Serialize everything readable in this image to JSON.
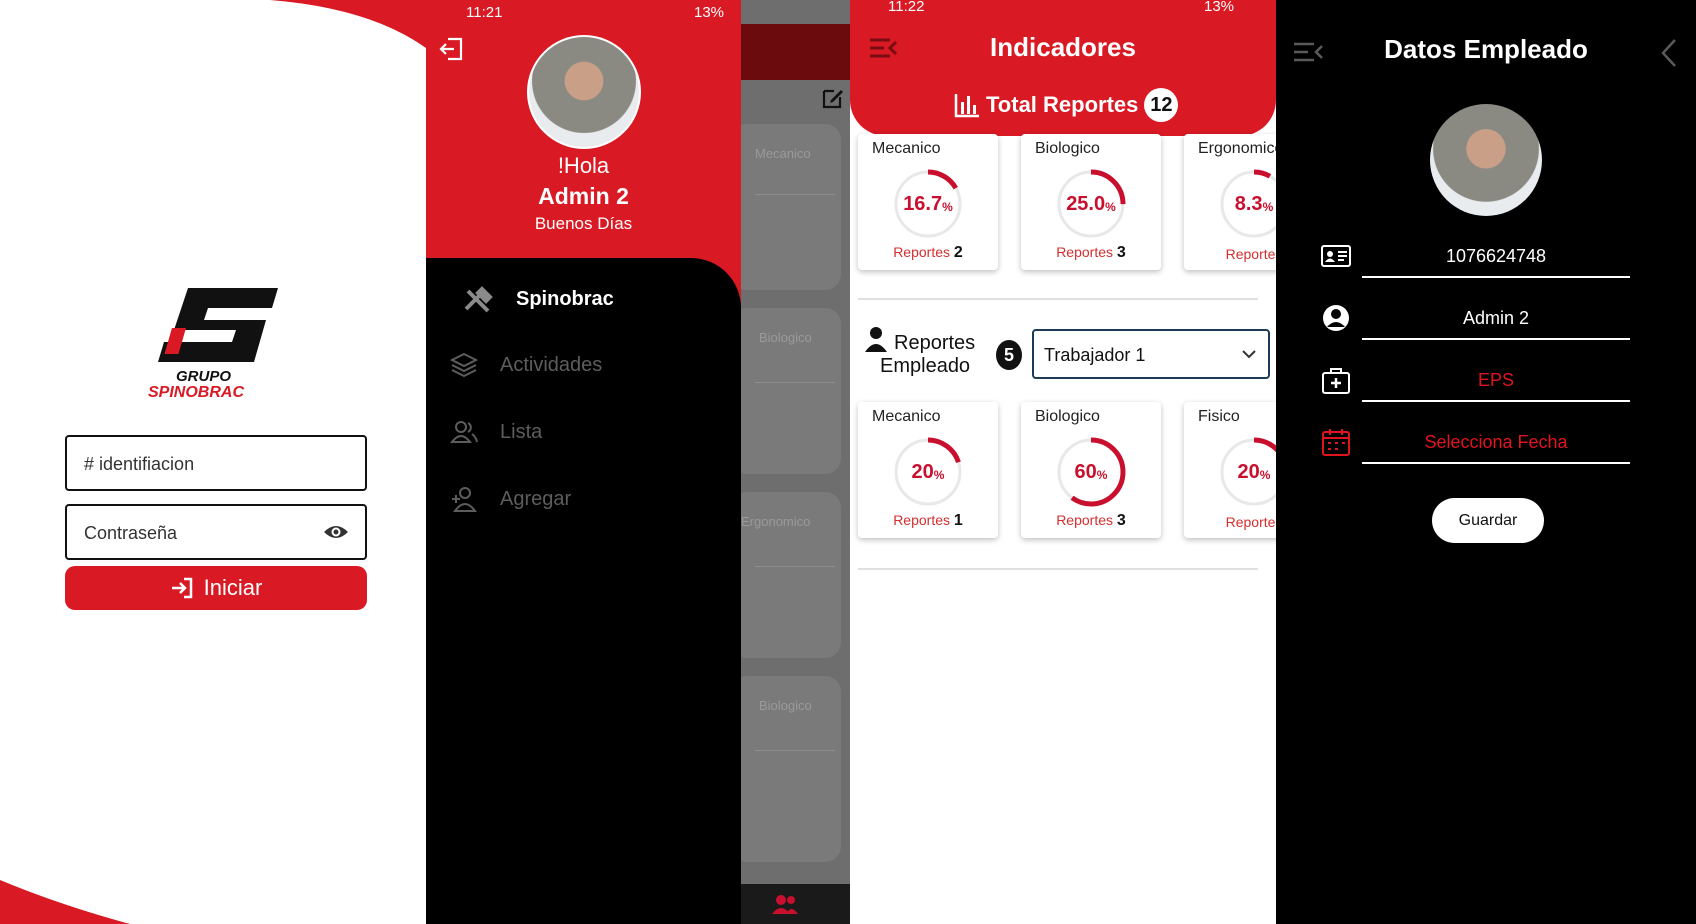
{
  "login": {
    "logo_top": "GRUPO",
    "logo_bottom": "SPINOBRAC",
    "id_placeholder": "# identifiacion",
    "password_placeholder": "Contraseña",
    "submit_label": "Iniciar"
  },
  "drawer": {
    "status_time": "11:21",
    "status_battery": "13%",
    "greeting": "!Hola",
    "user_name": "Admin 2",
    "subtitle": "Buenos Días",
    "items": [
      {
        "label": "Spinobrac",
        "icon": "tools-icon",
        "active": true
      },
      {
        "label": "Actividades",
        "icon": "layers-icon",
        "active": false
      },
      {
        "label": "Lista",
        "icon": "users-icon",
        "active": false
      },
      {
        "label": "Agregar",
        "icon": "add-user-icon",
        "active": false
      }
    ],
    "behind_cards": [
      "Mecanico",
      "Biologico",
      "Ergonomico",
      "Biologico"
    ]
  },
  "indicadores": {
    "status_time": "11:22",
    "status_battery": "13%",
    "title": "Indicadores",
    "total_label": "Total Reportes",
    "total_count": "12",
    "reportes_label": "Reportes",
    "top_cards": [
      {
        "title": "Mecanico",
        "value": 16.7,
        "display": "16.7",
        "reports": "2"
      },
      {
        "title": "Biologico",
        "value": 25.0,
        "display": "25.0",
        "reports": "3"
      },
      {
        "title": "Ergonomico",
        "value": 8.3,
        "display": "8.3",
        "reports": ""
      }
    ],
    "employee_label_1": "Reportes",
    "employee_label_2": "Empleado",
    "employee_count": "5",
    "select_value": "Trabajador 1",
    "bottom_cards": [
      {
        "title": "Mecanico",
        "value": 20,
        "display": "20",
        "reports": "1"
      },
      {
        "title": "Biologico",
        "value": 60,
        "display": "60",
        "reports": "3"
      },
      {
        "title": "Fisico",
        "value": 20,
        "display": "20",
        "reports": ""
      }
    ]
  },
  "empleado": {
    "title": "Datos Empleado",
    "id_number": "1076624748",
    "name": "Admin 2",
    "eps_placeholder": "EPS",
    "date_placeholder": "Selecciona Fecha",
    "save_label": "Guardar"
  },
  "colors": {
    "brand_red": "#d91923",
    "accent_red": "#c8102e"
  }
}
